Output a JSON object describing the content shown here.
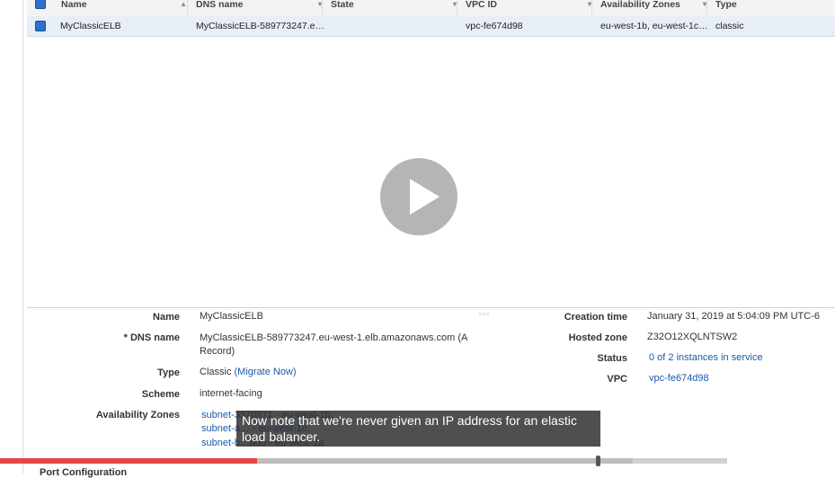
{
  "table": {
    "columns": [
      "Name",
      "DNS name",
      "State",
      "VPC ID",
      "Availability Zones",
      "Type"
    ],
    "row": {
      "name": "MyClassicELB",
      "dns": "MyClassicELB-589773247.e…",
      "state": "",
      "vpc": "vpc-fe674d98",
      "zones": "eu-west-1b, eu-west-1c…",
      "type": "classic"
    }
  },
  "details": {
    "name_label": "Name",
    "name_value": "MyClassicELB",
    "dns_label": "* DNS name",
    "dns_value_line1": "MyClassicELB-589773247.eu-west-1.elb.amazonaws.com (A",
    "dns_value_line2": "Record)",
    "type_label": "Type",
    "type_value": "Classic",
    "type_link": "(Migrate Now)",
    "scheme_label": "Scheme",
    "scheme_value": "internet-facing",
    "az_label": "Availability Zones",
    "az_values": [
      "subnet-3370871 - eu-west-1b,",
      "subnet-a… - eu-west-1c,",
      "subnet-b…bd0 - eu-west-1a"
    ],
    "creation_label": "Creation time",
    "creation_value": "January 31, 2019 at 5:04:09 PM UTC-6",
    "hosted_label": "Hosted zone",
    "hosted_value": "Z32O12XQLNTSW2",
    "status_label": "Status",
    "status_value": "0 of 2 instances in service",
    "vpc_label": "VPC",
    "vpc_value": "vpc-fe674d98"
  },
  "video": {
    "caption": "Now note that we're never given an IP address for an elastic load balancer.",
    "played_fraction": 0.353,
    "buffered_fraction": 0.87
  },
  "section_peek": "Port Configuration",
  "colors": {
    "accent": "#1a5aa6",
    "progress": "#e64545"
  }
}
